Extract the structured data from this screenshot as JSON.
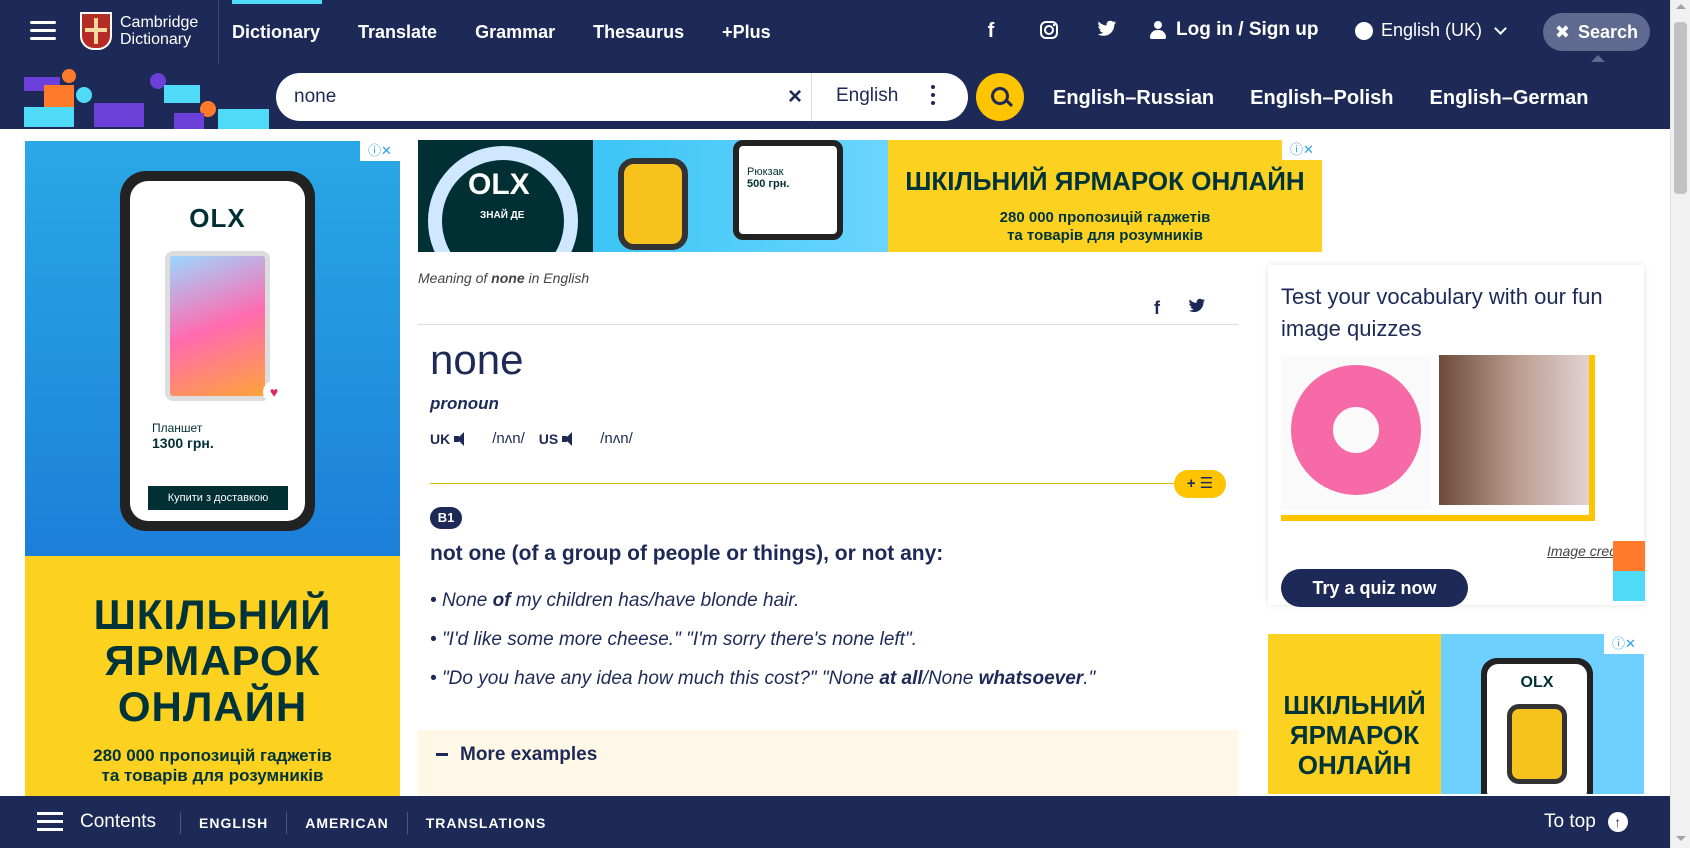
{
  "header": {
    "logo_line1": "Cambridge",
    "logo_line2": "Dictionary",
    "nav": [
      "Dictionary",
      "Translate",
      "Grammar",
      "Thesaurus",
      "+Plus"
    ],
    "social": [
      "facebook-icon",
      "instagram-icon",
      "twitter-icon"
    ],
    "login": "Log in / Sign up",
    "language": "English (UK)",
    "search_button": "Search"
  },
  "search": {
    "query": "none",
    "dictionary": "English",
    "pairs": [
      "English–Russian",
      "English–Polish",
      "English–German"
    ]
  },
  "ads": {
    "olx": "OLX",
    "znaide": "ЗНАЙ ДЕ",
    "tablet_label": "Планшет",
    "tablet_price": "1300 грн.",
    "backpack_label": "Рюкзак",
    "backpack_price": "500 грн.",
    "buy": "Купити з доставкою",
    "fair_line1": "ШКІЛЬНИЙ",
    "fair_line2": "ЯРМАРОК",
    "fair_line3": "ОНЛАЙН",
    "fair_title": "ШКІЛЬНИЙ ЯРМАРОК ОНЛАЙН",
    "offers_line1": "280 000 пропозицій гаджетів",
    "offers_line2": "та товарів для розумників",
    "close": "ⓘ✕"
  },
  "entry": {
    "breadcrumb_prefix": "Meaning of",
    "breadcrumb_word": "none",
    "breadcrumb_suffix": "in English",
    "word": "none",
    "pos": "pronoun",
    "uk_label": "UK",
    "uk_ipa": "/nʌn/",
    "us_label": "US",
    "us_ipa": "/nʌn/",
    "level": "B1",
    "definition": "not one (of a group of people or things), or not any:",
    "examples": [
      {
        "pre": "None ",
        "bold": "of",
        "post": " my children has/have blonde hair."
      },
      {
        "pre": "\"I'd like some more cheese.\" \"I'm sorry there's none left\".",
        "bold": "",
        "post": ""
      },
      {
        "pre": "\"Do you have any idea how much this cost?\" \"None ",
        "bold": "at all",
        "post": "/None ",
        "bold2": "whatsoever",
        "post2": ".\""
      }
    ],
    "more_examples": "More examples",
    "add_list": "+ ☰"
  },
  "quiz": {
    "title": "Test your vocabulary with our fun image quizzes",
    "credits": "Image credits",
    "button": "Try a quiz now"
  },
  "bottom": {
    "contents": "Contents",
    "tabs": [
      "ENGLISH",
      "AMERICAN",
      "TRANSLATIONS"
    ],
    "to_top": "To top"
  },
  "colors": {
    "navy": "#1d2a57",
    "yellow": "#fec400",
    "cyan": "#4fdbf7",
    "orange": "#ff7b2b"
  }
}
